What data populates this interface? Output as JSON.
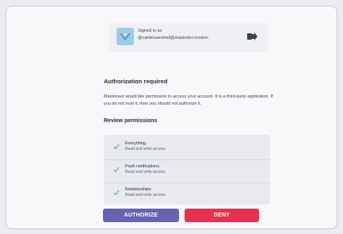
{
  "account": {
    "signed_in_label": "Signed in as",
    "handle": "@carlieruanshall@mastodon.london",
    "logout_icon": "sign-out-icon"
  },
  "authorization": {
    "title": "Authorization required",
    "description": "Mastonaut would like permission to access your account. It is a third-party application. If you do not trust it, then you should not authorize it."
  },
  "permissions": {
    "title": "Review permissions",
    "items": [
      {
        "name": "Everything",
        "scope": "Read and write access"
      },
      {
        "name": "Push notifications",
        "scope": "Read and write access"
      },
      {
        "name": "Relationships",
        "scope": "Read and write access"
      }
    ]
  },
  "actions": {
    "authorize_label": "AUTHORIZE",
    "deny_label": "DENY"
  },
  "colors": {
    "authorize": "#6364b2",
    "deny": "#e8304f",
    "check": "#79bd9a",
    "avatar": "#9bcdeb"
  }
}
